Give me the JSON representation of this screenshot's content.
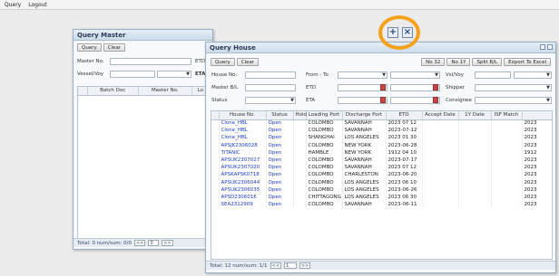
{
  "menu": {
    "query": "Query",
    "logout": "Logout"
  },
  "query_master": {
    "title": "Query Master",
    "buttons": {
      "query": "Query",
      "clear": "Clear"
    },
    "labels": {
      "master_no": "Master No.",
      "etd": "ETD",
      "vessel_voy": "Vessel/Voy",
      "eta": "ETA"
    },
    "columns": [
      "Batch Doc",
      "Master No.",
      "Lo"
    ],
    "footer": {
      "text": "Total: 0  num/sum: 0/0",
      "page": "0",
      "prev": "<<",
      "next": ">>"
    }
  },
  "query_house": {
    "title": "Query House",
    "buttons": {
      "query": "Query",
      "clear": "Clear",
      "no32": "No 32",
      "no1y": "No 1Y",
      "split": "Split B/L",
      "export": "Export To Excel"
    },
    "labels": {
      "house_no": "House No.",
      "master_bl": "Master B/L",
      "status": "Status",
      "from_to": "From - To",
      "etd": "ETD",
      "eta": "ETA",
      "vsl_voy": "Vsl/Voy",
      "shipper": "Shipper",
      "consignee": "Consignee"
    },
    "columns": [
      "House No.",
      "Status",
      "Hold",
      "Loading Port",
      "Discharge Port",
      "ETD",
      "Accept Date",
      "1Y Date",
      "ISF Match",
      ""
    ],
    "rows": [
      [
        "Clone_HBL",
        "Open",
        "",
        "COLOMBO",
        "SAVANNAH",
        "2023 07 12",
        "",
        "",
        "",
        "2023"
      ],
      [
        "Clone_HBL",
        "Open",
        "",
        "COLOMBO",
        "SAVANNAH",
        "2023-07-12",
        "",
        "",
        "",
        "2023"
      ],
      [
        "Clone_HBL",
        "Open",
        "",
        "SHANGHAI",
        "LOS ANGELES",
        "2023 01 30",
        "",
        "",
        "",
        "2023"
      ],
      [
        "APSJK2306028",
        "Open",
        "",
        "COLOMBO",
        "NEW YORK",
        "2023-06-28",
        "",
        "",
        "",
        "2023"
      ],
      [
        "TITANIC",
        "Open",
        "",
        "HAMBLE",
        "NEW YORK",
        "1912 04 10",
        "",
        "",
        "",
        "1912"
      ],
      [
        "APSUK2307027",
        "Open",
        "",
        "COLOMBO",
        "SAVANNAH",
        "2023-07-17",
        "",
        "",
        "",
        "2023"
      ],
      [
        "APSUK2307020",
        "Open",
        "",
        "COLOMBO",
        "SAVANNAH",
        "2023 07 12",
        "",
        "",
        "",
        "2023"
      ],
      [
        "APSKAPSK0718",
        "Open",
        "",
        "COLOMBO",
        "CHARLESTON",
        "2023-06-20",
        "",
        "",
        "",
        "2023"
      ],
      [
        "APSUK2306044",
        "Open",
        "",
        "COLOMBO",
        "LOS ANGELES",
        "2023 06 10",
        "",
        "",
        "",
        "2023"
      ],
      [
        "APSUK2306035",
        "Open",
        "",
        "COLOMBO",
        "LOS ANGELES",
        "2023-06-26",
        "",
        "",
        "",
        "2023"
      ],
      [
        "APSD2306016",
        "Open",
        "",
        "CHITTAGONG",
        "LOS ANGELES",
        "2023 06 30",
        "",
        "",
        "",
        "2023"
      ],
      [
        "SEA2312909",
        "Open",
        "",
        "COLOMBO",
        "SAVANNAH",
        "2023-06-11",
        "",
        "",
        "",
        "2023"
      ]
    ],
    "footer": {
      "text": "Total: 12  num/sum: 1/1",
      "page": "1",
      "prev": "<<",
      "next": ">>"
    }
  },
  "overlay": {
    "plus": "+",
    "close": "×",
    "ring_color": "#f5a11a"
  }
}
